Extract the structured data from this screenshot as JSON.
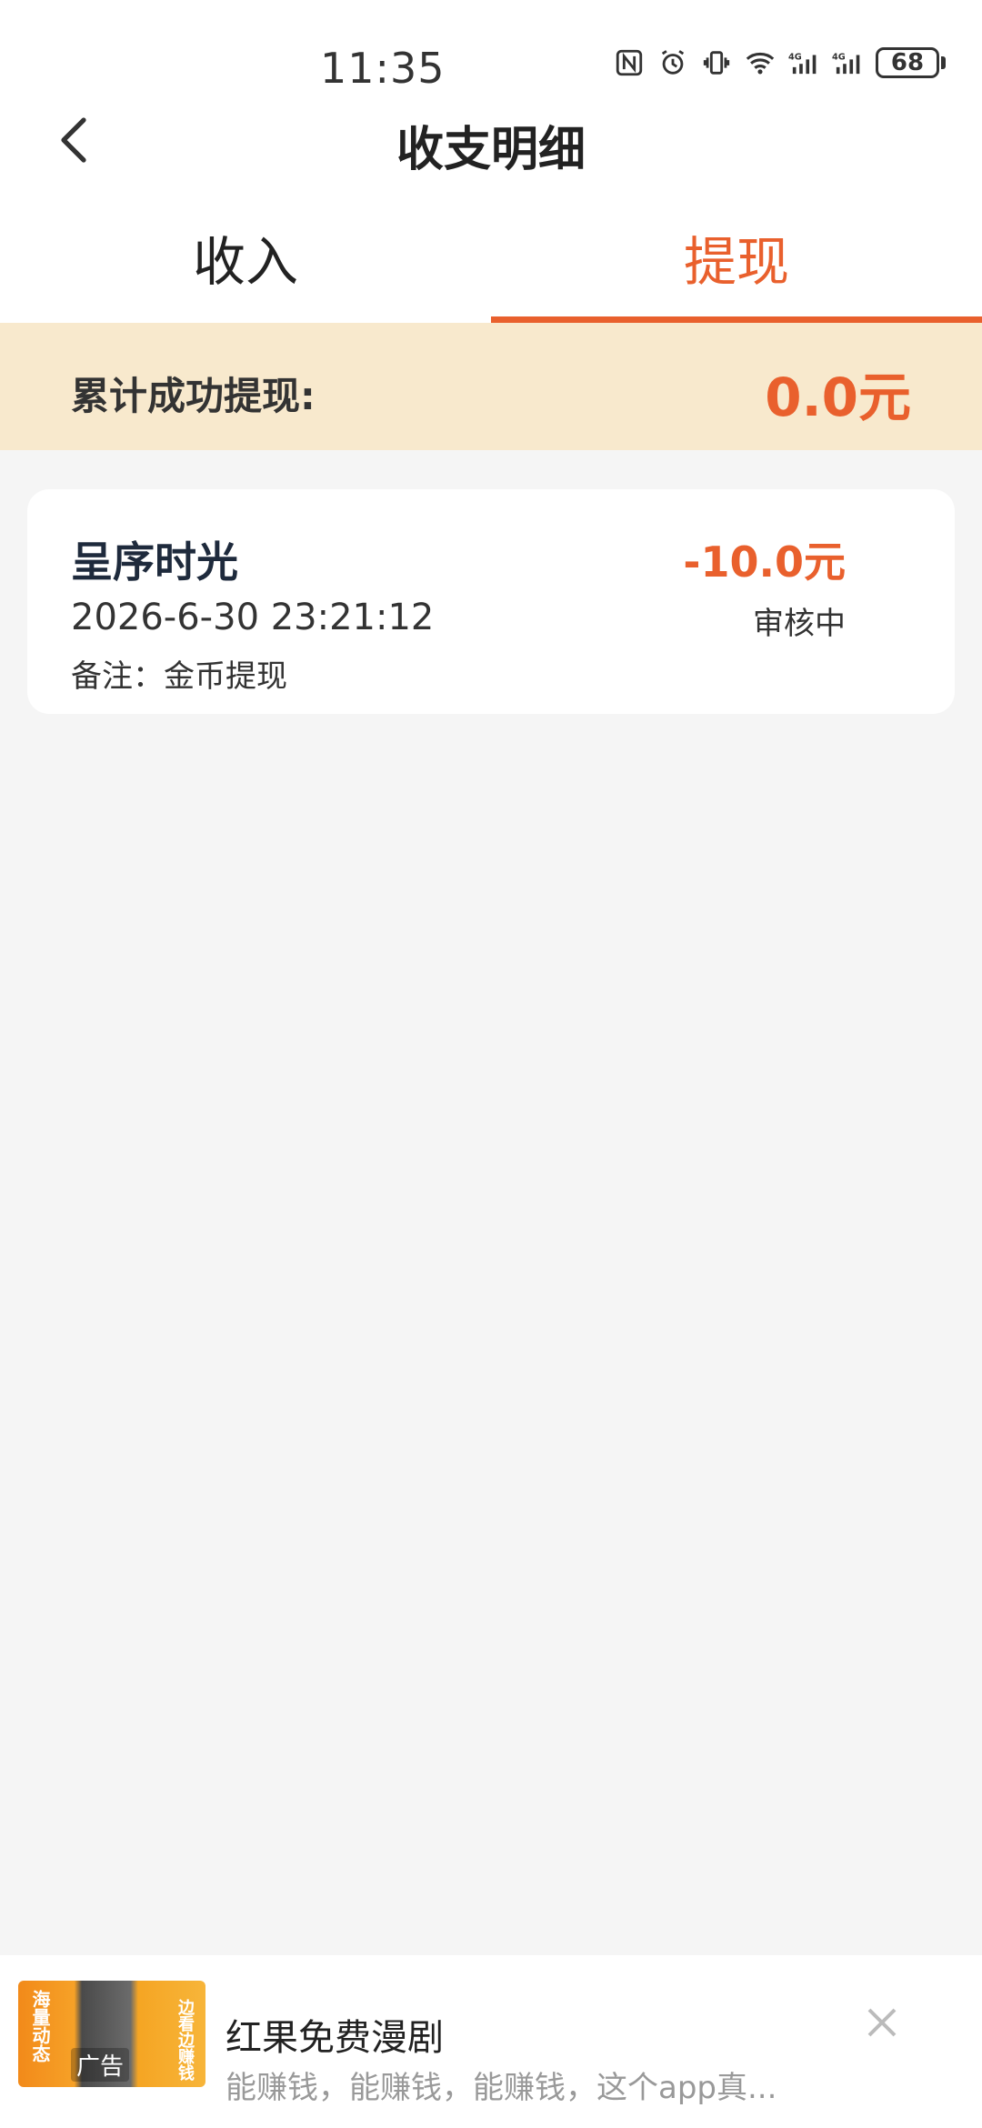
{
  "status_bar": {
    "time": "11:35",
    "battery": "68",
    "icons": [
      "nfc-icon",
      "alarm-icon",
      "vibrate-icon",
      "wifi-icon",
      "signal-4g-icon",
      "signal-4g-icon",
      "battery-icon"
    ]
  },
  "header": {
    "title": "收支明细",
    "back_icon": "chevron-left-icon"
  },
  "tabs": [
    {
      "label": "收入",
      "active": false
    },
    {
      "label": "提现",
      "active": true
    }
  ],
  "summary": {
    "label": "累计成功提现:",
    "value": "0.0元"
  },
  "records": [
    {
      "title": "呈序时光",
      "time": "2026-6-30 23:21:12",
      "note": "备注：金币提现",
      "amount": "-10.0元",
      "status": "审核中"
    }
  ],
  "ad": {
    "title": "红果免费漫剧",
    "description": "能赚钱，能赚钱，能赚钱，这个app真...",
    "tag": "广告",
    "thumb_left_text": "海量动态",
    "thumb_right_text": "边看边赚钱",
    "close_icon": "close-icon"
  },
  "colors": {
    "accent": "#e9602d",
    "summary_bg": "#f8e9cd",
    "page_bg": "#f5f5f5"
  }
}
